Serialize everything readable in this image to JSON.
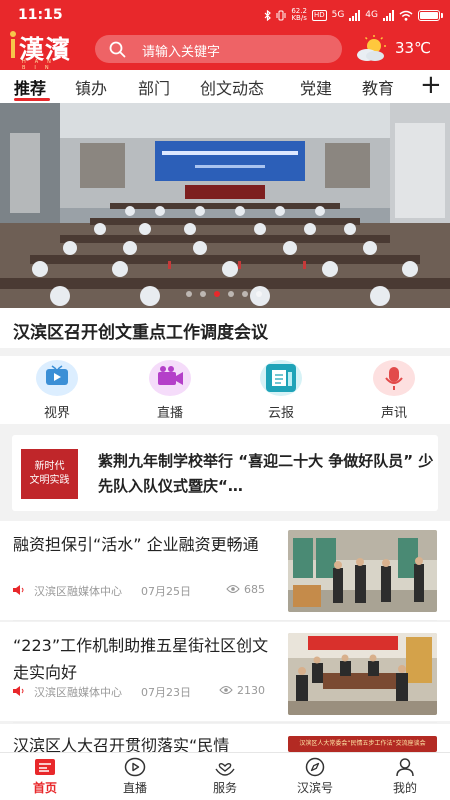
{
  "status_bar": {
    "time": "11:15",
    "net_speed_value": "62.2",
    "net_speed_unit": "KB/s",
    "hd": "HD",
    "network": "5G",
    "network2": "4G",
    "battery_level": 0.9
  },
  "app": {
    "logo_text": "漢濱",
    "logo_sub": "HAN BIN"
  },
  "search": {
    "placeholder": "请输入关键字"
  },
  "weather": {
    "temperature": "33℃",
    "icon": "partly-cloudy-icon"
  },
  "tabs": [
    {
      "label": "推荐",
      "active": true
    },
    {
      "label": "镇办"
    },
    {
      "label": "部门"
    },
    {
      "label": "创文动态"
    },
    {
      "label": "党建"
    },
    {
      "label": "教育"
    }
  ],
  "tabs_more": "+",
  "banner": {
    "headline": "汉滨区召开创文重点工作调度会议",
    "slide_count": 6,
    "active_slide": 2
  },
  "quick_links": [
    {
      "label": "视界",
      "icon": "tv-icon",
      "color": "#3b8fd6"
    },
    {
      "label": "直播",
      "icon": "video-camera-icon",
      "color": "#b43fc9"
    },
    {
      "label": "云报",
      "icon": "newspaper-icon",
      "color": "#1fa3b8"
    },
    {
      "label": "声讯",
      "icon": "microphone-icon",
      "color": "#e24a4a"
    }
  ],
  "feature": {
    "badge_line1": "新时代",
    "badge_line2": "文明实践",
    "title": "紫荆九年制学校举行  “喜迎二十大 争做好队员”  少先队入队仪式暨庆“…"
  },
  "news": [
    {
      "title": "融资担保引“活水”  企业融资更畅通",
      "source": "汉滨区融媒体中心",
      "date": "07月25日",
      "views": "685"
    },
    {
      "title": "“223”工作机制助推五星街社区创文走实向好",
      "source": "汉滨区融媒体中心",
      "date": "07月23日",
      "views": "2130"
    },
    {
      "title": "汉滨区人大召开贯彻落实“民情",
      "thumb_caption": "汉滨区人大常委会“民情五步工作法”",
      "thumb_caption2": "交流座谈会"
    }
  ],
  "bottom_nav": [
    {
      "label": "首页",
      "icon": "home-news-icon",
      "active": true
    },
    {
      "label": "直播",
      "icon": "live-play-icon"
    },
    {
      "label": "服务",
      "icon": "service-hands-icon"
    },
    {
      "label": "汉滨号",
      "icon": "compass-icon"
    },
    {
      "label": "我的",
      "icon": "profile-icon"
    }
  ],
  "colors": {
    "brand": "#e8282b",
    "text": "#222222",
    "meta": "#999999"
  }
}
